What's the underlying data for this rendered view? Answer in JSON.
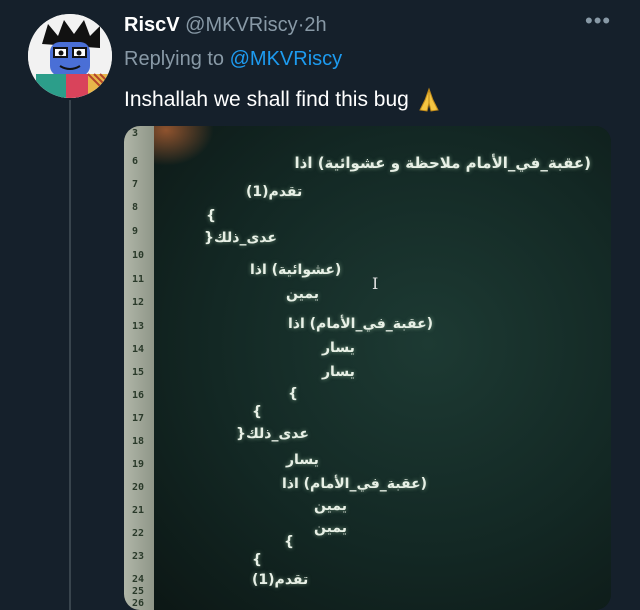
{
  "tweet": {
    "display_name": "RiscV",
    "handle": "@MKVRiscy",
    "separator": "·",
    "timestamp": "2h",
    "more_icon": "more-horizontal-icon",
    "replying_prefix": "Replying to",
    "replying_mention": "@MKVRiscy",
    "text": "Inshallah we shall find this bug",
    "emoji": "folded-hands-icon"
  },
  "code_image": {
    "line_numbers": [
      "3",
      "6",
      "7",
      "8",
      "9",
      "10",
      "11",
      "12",
      "13",
      "14",
      "15",
      "16",
      "17",
      "18",
      "19",
      "20",
      "21",
      "22",
      "23",
      "24",
      "25",
      "26"
    ],
    "lines": [
      "(عقبة_في_الأمام ملاحظة و عشوائية) اذا",
      "تقدم(1)",
      "}",
      "عدى_ذلك{",
      "(عشوائية) اذا",
      "يمين",
      "(عقبة_في_الأمام) اذا",
      "يسار",
      "يسار",
      "}",
      "}",
      "عدى_ذلك{",
      "يسار",
      "(عقبة_في_الأمام) اذا",
      "يمين",
      "يمين",
      "}",
      "}",
      "تقدم(1)"
    ]
  }
}
